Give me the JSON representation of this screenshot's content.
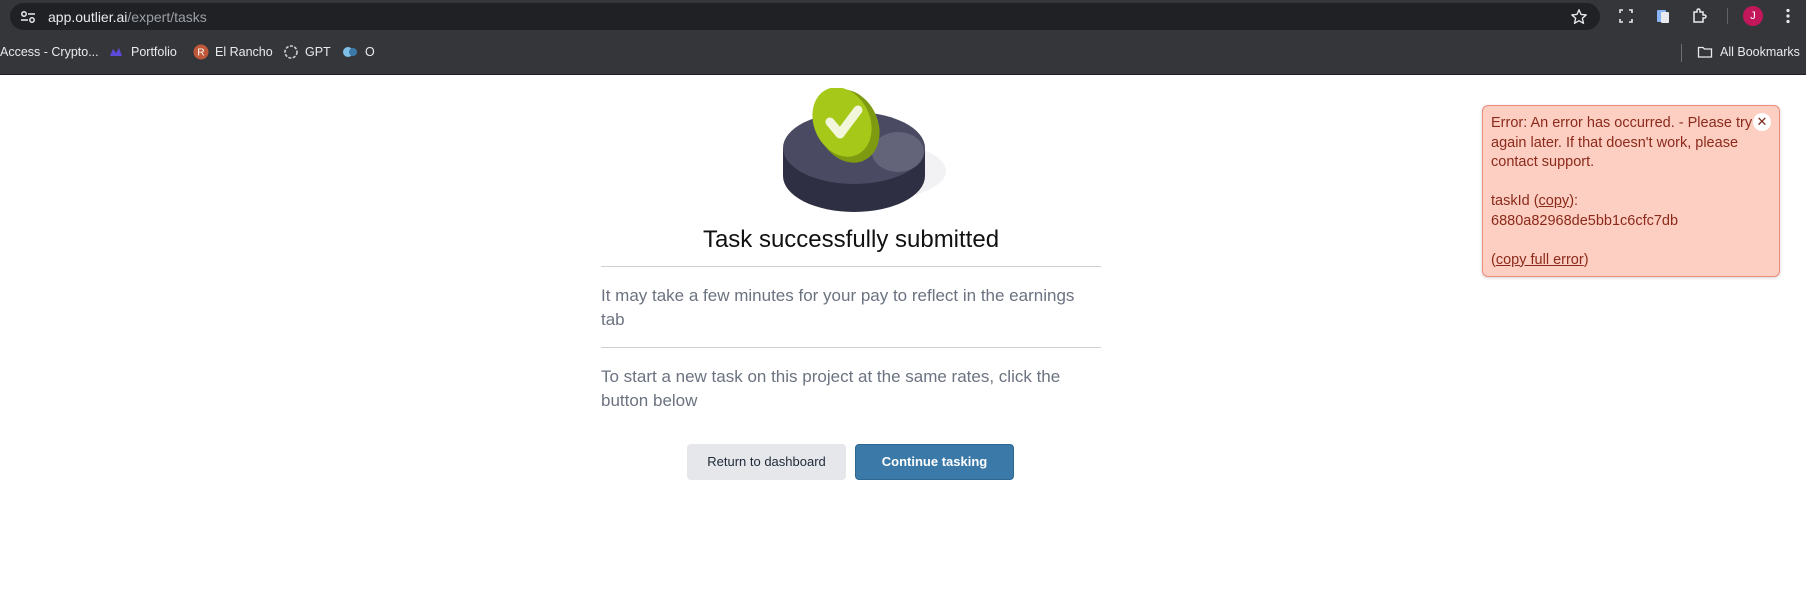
{
  "browser": {
    "url_host": "app.outlier.ai",
    "url_path": "/expert/tasks",
    "avatar_initial": "J",
    "bookmarks": [
      {
        "label": "Access - Crypto...",
        "icon": "bookmark-page-icon"
      },
      {
        "label": "Portfolio",
        "icon": "portfolio-icon"
      },
      {
        "label": "El Rancho",
        "icon": "el-rancho-icon"
      },
      {
        "label": "GPT",
        "icon": "openai-icon"
      },
      {
        "label": "O",
        "icon": "outlier-icon"
      }
    ],
    "all_bookmarks_label": "All Bookmarks"
  },
  "main": {
    "title": "Task successfully submitted",
    "paragraph1": "It may take a few minutes for your pay to reflect in the earnings tab",
    "paragraph2": "To start a new task on this project at the same rates, click the button below",
    "return_button": "Return to dashboard",
    "continue_button": "Continue tasking"
  },
  "toast": {
    "message": "Error: An error has occurred. - Please try again later. If that doesn't work, please contact support.",
    "task_id_label": "taskId (",
    "copy_link": "copy",
    "task_id_suffix": "):",
    "task_id": "6880a82968de5bb1c6cfc7db",
    "copy_full_open": "(",
    "copy_full_link": "copy full error",
    "copy_full_close": ")",
    "close_glyph": "✕"
  },
  "colors": {
    "primary_button": "#3b79a9",
    "toast_bg": "#fdcfc3",
    "toast_text": "#8b2a1a",
    "check_green": "#a6c818"
  }
}
